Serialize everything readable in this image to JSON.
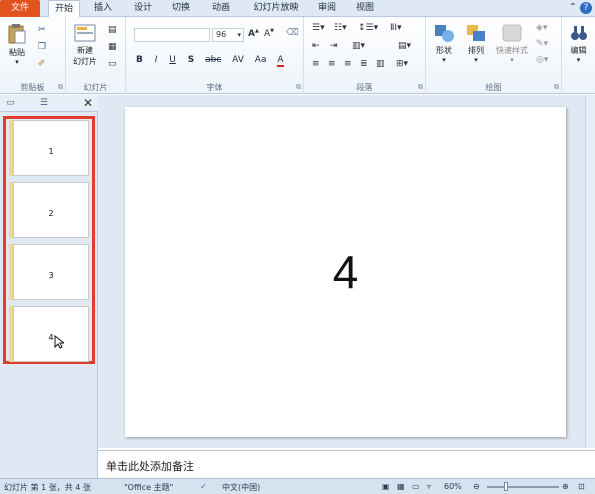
{
  "tabs": {
    "file": "文件",
    "home": "开始",
    "insert": "插入",
    "design": "设计",
    "transitions": "切换",
    "animations": "动画",
    "slideshow": "幻灯片放映",
    "review": "审阅",
    "view": "视图"
  },
  "ribbon": {
    "clipboard": {
      "paste": "粘贴",
      "label": "剪贴板"
    },
    "slides": {
      "new_slide_line1": "新建",
      "new_slide_line2": "幻灯片",
      "label": "幻灯片"
    },
    "font": {
      "font_name": "",
      "font_size": "96",
      "bold": "B",
      "italic": "I",
      "underline": "U",
      "shadow": "S",
      "strike": "abc",
      "spacing": "AV",
      "case": "Aa",
      "color": "A",
      "grow": "A",
      "shrink": "A",
      "label": "字体"
    },
    "paragraph": {
      "label": "段落"
    },
    "drawing": {
      "shapes": "形状",
      "arrange": "排列",
      "quick_styles": "快速样式",
      "label": "绘图"
    },
    "editing": {
      "edit": "编辑"
    }
  },
  "slides_pane": {
    "thumbnails": [
      {
        "number": "1"
      },
      {
        "number": "2"
      },
      {
        "number": "3"
      },
      {
        "number": "4"
      }
    ]
  },
  "slide": {
    "content": "4"
  },
  "notes": {
    "placeholder": "单击此处添加备注"
  },
  "status": {
    "slide_info": "幻灯片 第 1 张，共 4 张",
    "theme": "\"Office 主题\"",
    "language": "中文(中国)",
    "zoom": "60%"
  },
  "colors": {
    "file_tab": "#e2531e",
    "selection_frame": "#e33b2e",
    "workspace": "#dfe8f3"
  }
}
